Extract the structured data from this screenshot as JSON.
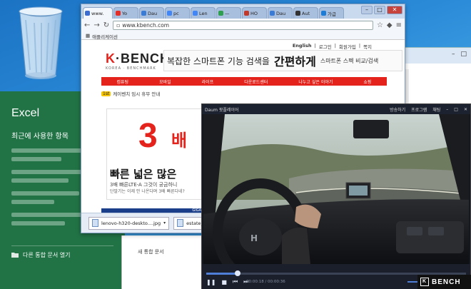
{
  "browser": {
    "tabs": [
      {
        "label": "www.",
        "color": "#3b6dd1",
        "active": true
      },
      {
        "label": "Yo",
        "color": "#e52d27"
      },
      {
        "label": "Dau",
        "color": "#3a7bd5"
      },
      {
        "label": "pc",
        "color": "#4285f4"
      },
      {
        "label": "Len",
        "color": "#4285f4"
      },
      {
        "label": "—",
        "color": "#2e9e4f"
      },
      {
        "label": "HO",
        "color": "#c0392b"
      },
      {
        "label": "Dau",
        "color": "#3a7bd5"
      },
      {
        "label": "Aut",
        "color": "#333333"
      },
      {
        "label": "가급",
        "color": "#1c7cd6"
      }
    ],
    "url": "www.kbench.com",
    "bookmarks_label": "애플리케이션",
    "toplinks": [
      "English",
      "로그인",
      "회원가입",
      "쪽지"
    ],
    "site": {
      "logo_k": "K",
      "logo_rest": "·BENCH",
      "logo_sub": "KOREA · BENCHMARK",
      "banner_left": "복잡한 스마트폰 기능 검색을",
      "banner_mid": "간편하게",
      "banner_right": "스마트폰 스펙 비교/검색",
      "nav": [
        "컴퓨팅",
        "모바일",
        "라이프",
        "다운로드센터",
        "나누고 싶은 이야기",
        "쇼핑"
      ],
      "notice": "케이벤치 임시 휴무 안내",
      "ad_number": "3",
      "ad_unit": "배",
      "ad_slogan": "빠른 넓은 많은",
      "ad_sub": "3배 빠른LTE-A 그것이 궁금하니",
      "ad_sub2": "단말기는 이제 안 나온다며 3배 빠른다네?",
      "ad_strip_left": "",
      "ad_strip_right": "GIGA"
    },
    "downloads": [
      "lenovo-h320-deskto....jpg",
      "estate_2.jpg"
    ]
  },
  "excel": {
    "title": "Excel",
    "recent": "최근에 사용한 항목",
    "open_other": "다른 통합 문서 열기",
    "sheet_label": "새 통합 문서"
  },
  "player": {
    "brand": "Daum 팟플레이어",
    "menu": "",
    "right_items": [
      "방송하기",
      "프로그램",
      "채팅"
    ],
    "file_info": "",
    "time": "00:00:18 / 00:00:36",
    "progress": 0.12
  },
  "watermark": {
    "text": "BENCH",
    "mark": "K"
  }
}
